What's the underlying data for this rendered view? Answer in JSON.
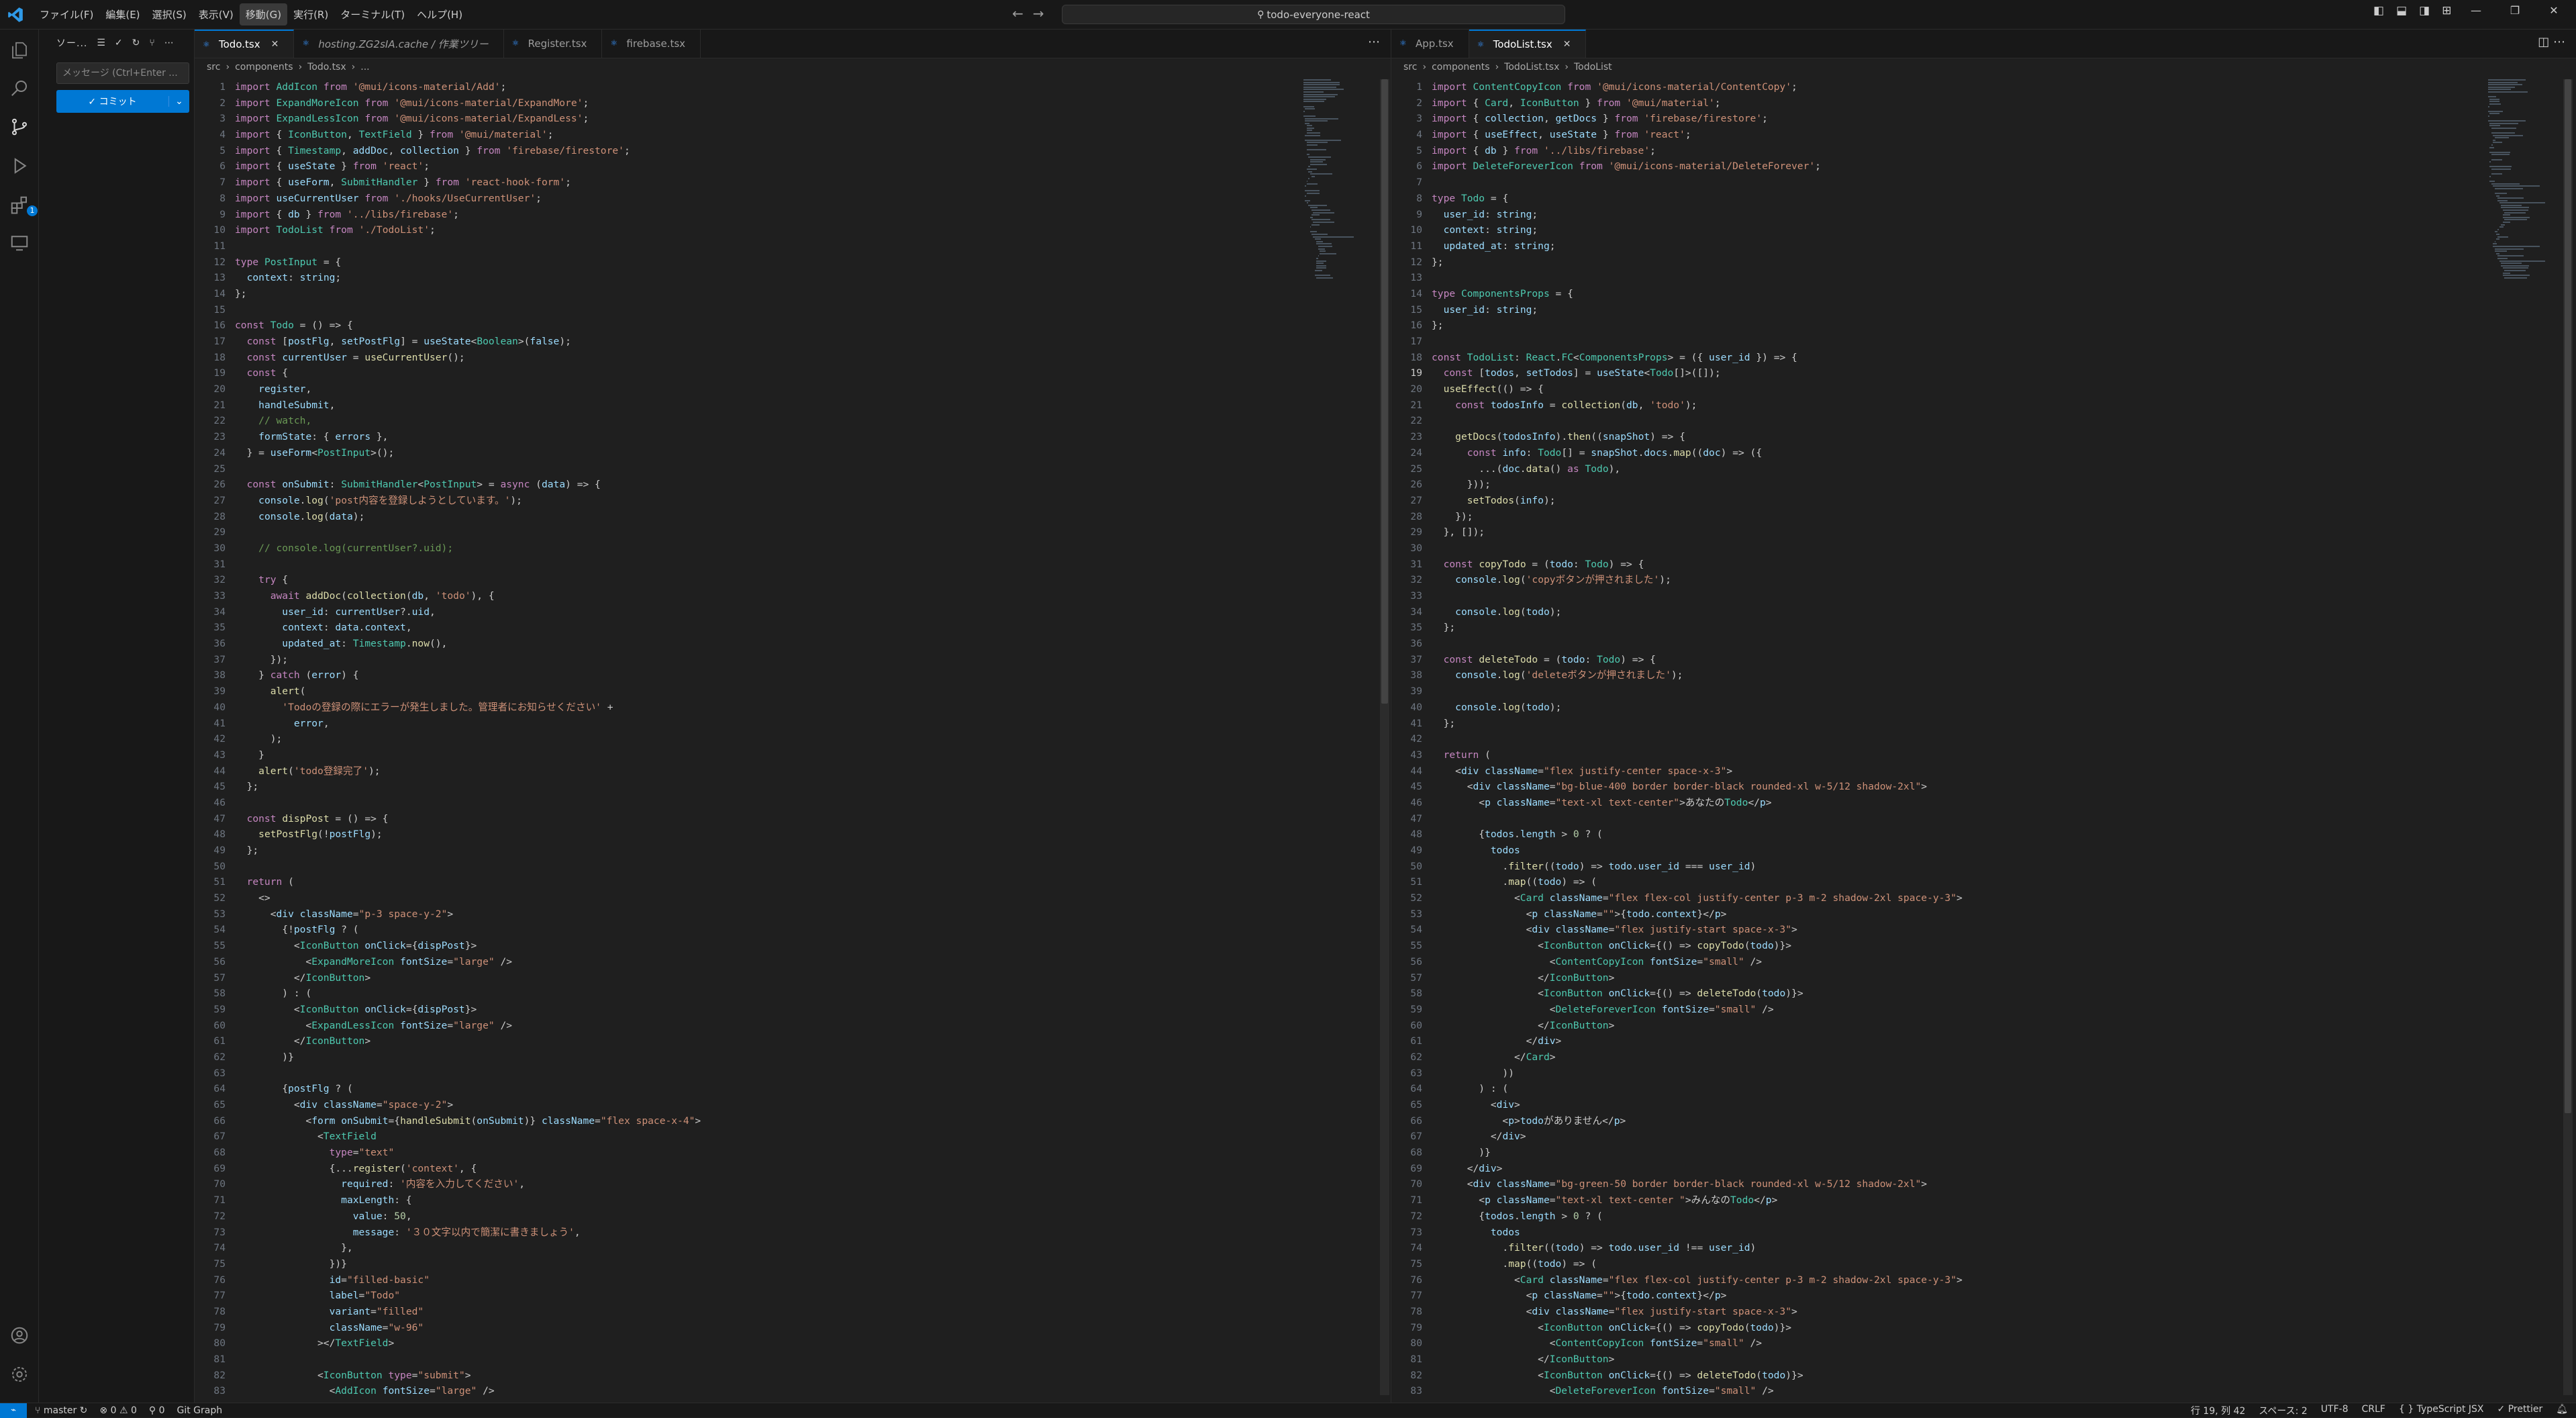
{
  "titlebar": {
    "menus": [
      "ファイル(F)",
      "編集(E)",
      "選択(S)",
      "表示(V)",
      "移動(G)",
      "実行(R)",
      "ターミナル(T)",
      "ヘルプ(H)"
    ],
    "active_menu": "移動(G)",
    "search": "todo-everyone-react"
  },
  "sidebar": {
    "title": "ソー...",
    "message_placeholder": "メッセージ (Ctrl+Enter ...",
    "commit_label": "✓ コミット"
  },
  "left_editor": {
    "tabs": [
      {
        "label": "Todo.tsx",
        "state": "active"
      },
      {
        "label": "hosting.ZG2sIA.cache / 作業ツリー",
        "state": "italic"
      },
      {
        "label": "Register.tsx",
        "state": "normal"
      },
      {
        "label": "firebase.tsx",
        "state": "normal"
      }
    ],
    "breadcrumb": [
      "src",
      "components",
      "Todo.tsx",
      "..."
    ],
    "lines": [
      "import AddIcon from '@mui/icons-material/Add';",
      "import ExpandMoreIcon from '@mui/icons-material/ExpandMore';",
      "import ExpandLessIcon from '@mui/icons-material/ExpandLess';",
      "import { IconButton, TextField } from '@mui/material';",
      "import { Timestamp, addDoc, collection } from 'firebase/firestore';",
      "import { useState } from 'react';",
      "import { useForm, SubmitHandler } from 'react-hook-form';",
      "import useCurrentUser from './hooks/UseCurrentUser';",
      "import { db } from '../libs/firebase';",
      "import TodoList from './TodoList';",
      "",
      "type PostInput = {",
      "  context: string;",
      "};",
      "",
      "const Todo = () => {",
      "  const [postFlg, setPostFlg] = useState<Boolean>(false);",
      "  const currentUser = useCurrentUser();",
      "  const {",
      "    register,",
      "    handleSubmit,",
      "    // watch,",
      "    formState: { errors },",
      "  } = useForm<PostInput>();",
      "",
      "  const onSubmit: SubmitHandler<PostInput> = async (data) => {",
      "    console.log('post内容を登録しようとしています。');",
      "    console.log(data);",
      "",
      "    // console.log(currentUser?.uid);",
      "",
      "    try {",
      "      await addDoc(collection(db, 'todo'), {",
      "        user_id: currentUser?.uid,",
      "        context: data.context,",
      "        updated_at: Timestamp.now(),",
      "      });",
      "    } catch (error) {",
      "      alert(",
      "        'Todoの登録の際にエラーが発生しました。管理者にお知らせください' +",
      "          error,",
      "      );",
      "    }",
      "    alert('todo登録完了');",
      "  };",
      "",
      "  const dispPost = () => {",
      "    setPostFlg(!postFlg);",
      "  };",
      "",
      "  return (",
      "    <>",
      "      <div className=\"p-3 space-y-2\">",
      "        {!postFlg ? (",
      "          <IconButton onClick={dispPost}>",
      "            <ExpandMoreIcon fontSize=\"large\" />",
      "          </IconButton>",
      "        ) : (",
      "          <IconButton onClick={dispPost}>",
      "            <ExpandLessIcon fontSize=\"large\" />",
      "          </IconButton>",
      "        )}",
      "",
      "        {postFlg ? (",
      "          <div className=\"space-y-2\">",
      "            <form onSubmit={handleSubmit(onSubmit)} className=\"flex space-x-4\">",
      "              <TextField",
      "                type=\"text\"",
      "                {...register('context', {",
      "                  required: '内容を入力してください',",
      "                  maxLength: {",
      "                    value: 50,",
      "                    message: '３０文字以内で簡潔に書きましょう',",
      "                  },",
      "                })}",
      "                id=\"filled-basic\"",
      "                label=\"Todo\"",
      "                variant=\"filled\"",
      "                className=\"w-96\"",
      "              ></TextField>",
      "",
      "              <IconButton type=\"submit\">",
      "                <AddIcon fontSize=\"large\" />"
    ]
  },
  "right_editor": {
    "tabs": [
      {
        "label": "App.tsx",
        "state": "normal"
      },
      {
        "label": "TodoList.tsx",
        "state": "active"
      }
    ],
    "breadcrumb": [
      "src",
      "components",
      "TodoList.tsx",
      "TodoList"
    ],
    "current_line": 19,
    "lines": [
      "import ContentCopyIcon from '@mui/icons-material/ContentCopy';",
      "import { Card, IconButton } from '@mui/material';",
      "import { collection, getDocs } from 'firebase/firestore';",
      "import { useEffect, useState } from 'react';",
      "import { db } from '../libs/firebase';",
      "import DeleteForeverIcon from '@mui/icons-material/DeleteForever';",
      "",
      "type Todo = {",
      "  user_id: string;",
      "  context: string;",
      "  updated_at: string;",
      "};",
      "",
      "type ComponentsProps = {",
      "  user_id: string;",
      "};",
      "",
      "const TodoList: React.FC<ComponentsProps> = ({ user_id }) => {",
      "  const [todos, setTodos] = useState<Todo[]>([]);",
      "  useEffect(() => {",
      "    const todosInfo = collection(db, 'todo');",
      "",
      "    getDocs(todosInfo).then((snapShot) => {",
      "      const info: Todo[] = snapShot.docs.map((doc) => ({",
      "        ...(doc.data() as Todo),",
      "      }));",
      "      setTodos(info);",
      "    });",
      "  }, []);",
      "",
      "  const copyTodo = (todo: Todo) => {",
      "    console.log('copyボタンが押されました');",
      "",
      "    console.log(todo);",
      "  };",
      "",
      "  const deleteTodo = (todo: Todo) => {",
      "    console.log('deleteボタンが押されました');",
      "",
      "    console.log(todo);",
      "  };",
      "",
      "  return (",
      "    <div className=\"flex justify-center space-x-3\">",
      "      <div className=\"bg-blue-400 border border-black rounded-xl w-5/12 shadow-2xl\">",
      "        <p className=\"text-xl text-center\">あなたのTodo</p>",
      "",
      "        {todos.length > 0 ? (",
      "          todos",
      "            .filter((todo) => todo.user_id === user_id)",
      "            .map((todo) => (",
      "              <Card className=\"flex flex-col justify-center p-3 m-2 shadow-2xl space-y-3\">",
      "                <p className=\"\">{todo.context}</p>",
      "                <div className=\"flex justify-start space-x-3\">",
      "                  <IconButton onClick={() => copyTodo(todo)}>",
      "                    <ContentCopyIcon fontSize=\"small\" />",
      "                  </IconButton>",
      "                  <IconButton onClick={() => deleteTodo(todo)}>",
      "                    <DeleteForeverIcon fontSize=\"small\" />",
      "                  </IconButton>",
      "                </div>",
      "              </Card>",
      "            ))",
      "        ) : (",
      "          <div>",
      "            <p>todoがありません</p>",
      "          </div>",
      "        )}",
      "      </div>",
      "      <div className=\"bg-green-50 border border-black rounded-xl w-5/12 shadow-2xl\">",
      "        <p className=\"text-xl text-center \">みんなのTodo</p>",
      "        {todos.length > 0 ? (",
      "          todos",
      "            .filter((todo) => todo.user_id !== user_id)",
      "            .map((todo) => (",
      "              <Card className=\"flex flex-col justify-center p-3 m-2 shadow-2xl space-y-3\">",
      "                <p className=\"\">{todo.context}</p>",
      "                <div className=\"flex justify-start space-x-3\">",
      "                  <IconButton onClick={() => copyTodo(todo)}>",
      "                    <ContentCopyIcon fontSize=\"small\" />",
      "                  </IconButton>",
      "                  <IconButton onClick={() => deleteTodo(todo)}>",
      "                    <DeleteForeverIcon fontSize=\"small\" />"
    ]
  },
  "statusbar": {
    "branch": "master",
    "problems": "⊗ 0 ⚠ 0",
    "ports": "⚲ 0",
    "git_graph": "Git Graph",
    "position": "行 19, 列 42",
    "spaces": "スペース: 2",
    "encoding": "UTF-8",
    "eol": "CRLF",
    "language": "{ } TypeScript JSX",
    "formatter": "✓ Prettier"
  },
  "colors": {
    "accent": "#0078d4",
    "keyword": "#c586c0",
    "string": "#ce9178",
    "type": "#4ec9b0",
    "variable": "#9cdcfe",
    "function": "#dcdcaa",
    "comment": "#6a9955"
  }
}
